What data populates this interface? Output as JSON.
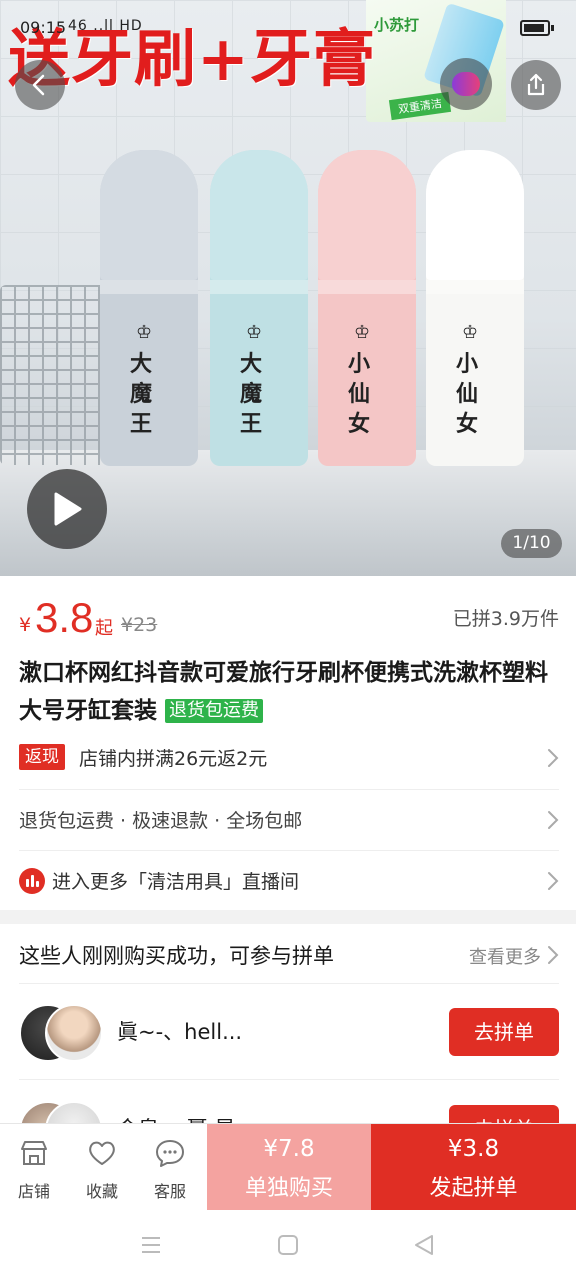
{
  "status_bar": {
    "time": "09:15",
    "network": "46 ..ll HD"
  },
  "hero": {
    "promo_banner": "送牙刷+牙膏",
    "promo_box_title": "小苏打",
    "promo_box_tag": "双重清洁",
    "cup_labels": [
      "大魔王",
      "大魔王",
      "小仙女",
      "小仙女"
    ],
    "image_counter": "1/10"
  },
  "product": {
    "currency": "¥",
    "price": "3.8",
    "price_suffix": "起",
    "original_price": "¥23",
    "sold_count": "已拼3.9万件",
    "title": "漱口杯网红抖音款可爱旅行牙刷杯便携式洗漱杯塑料大号牙缸套装",
    "title_tag": "退货包运费",
    "cashback_tag": "返现",
    "cashback_text": "店铺内拼满26元返2元",
    "services": "退货包运费 · 极速退款 · 全场包邮",
    "live_text": "进入更多「清洁用具」直播间"
  },
  "group_buy": {
    "heading": "这些人刚刚购买成功，可参与拼单",
    "see_more": "查看更多",
    "buyers": [
      {
        "name": "眞~-、hell...",
        "button": "去拼单"
      },
      {
        "name": "含泉 、聂 是",
        "button": "去拼单"
      }
    ]
  },
  "bottom_bar": {
    "store": "店铺",
    "favorite": "收藏",
    "service": "客服",
    "alone_price": "¥7.8",
    "alone_label": "单独购买",
    "group_price": "¥3.8",
    "group_label": "发起拼单"
  },
  "colors": {
    "accent": "#e02e24",
    "green_tag": "#2eb34a",
    "light_accent": "#f4a3a0"
  }
}
